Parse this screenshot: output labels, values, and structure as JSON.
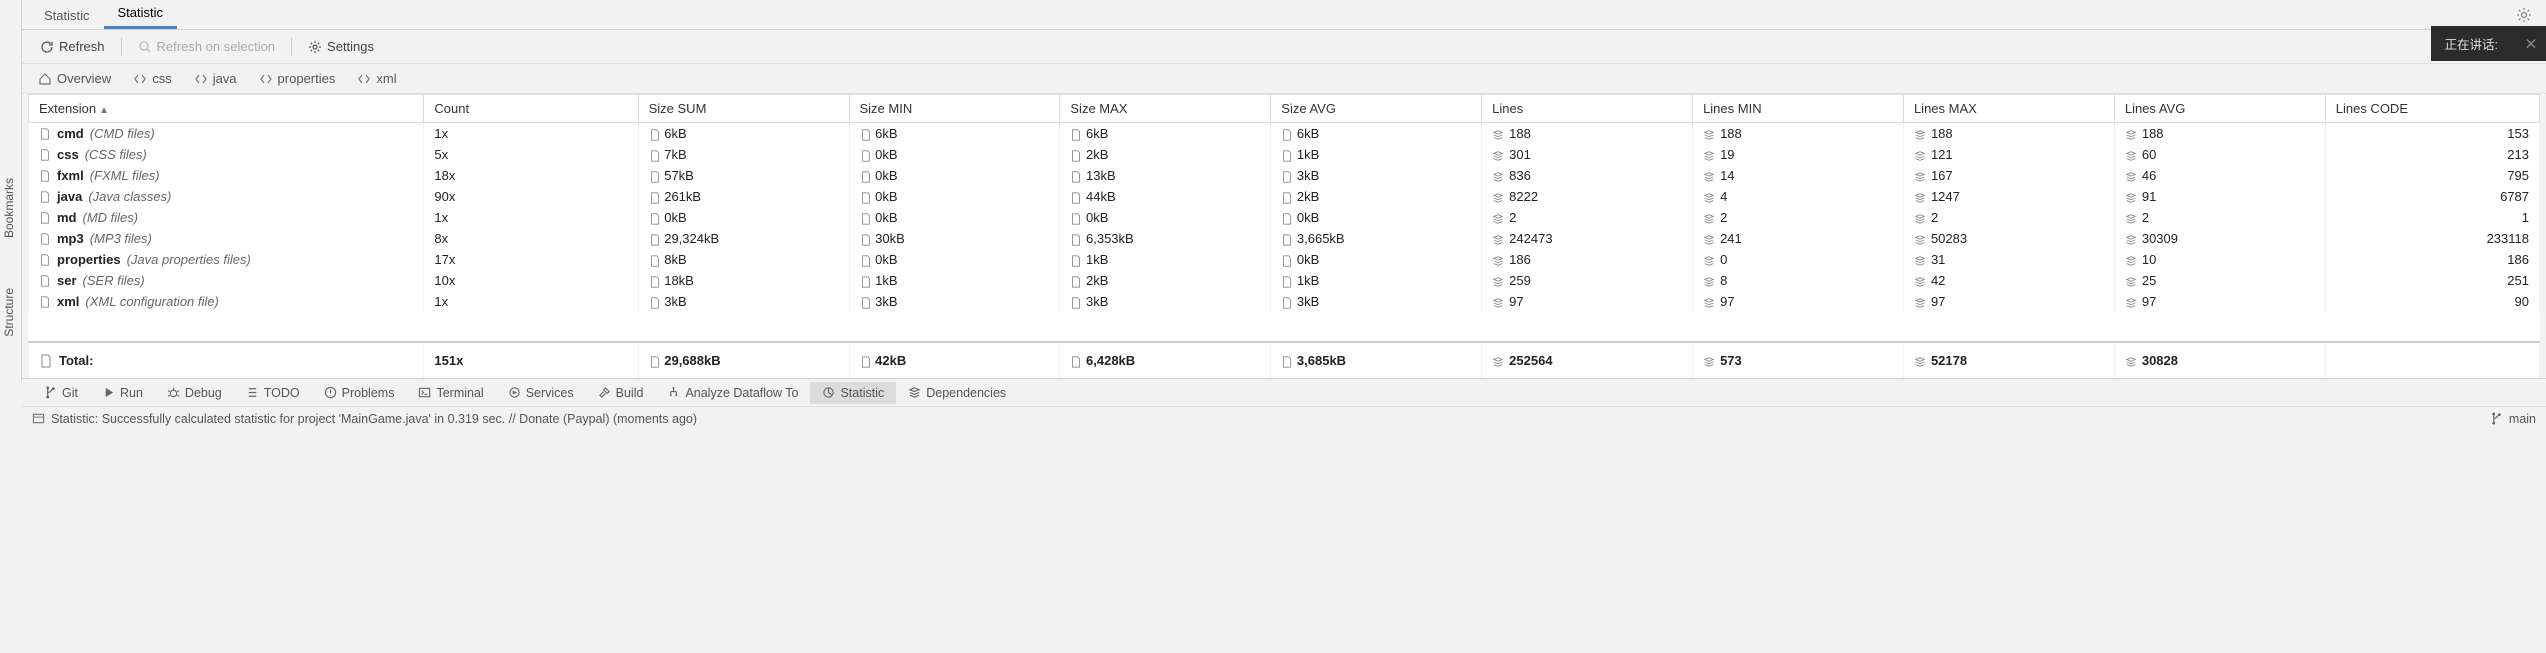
{
  "top_tabs": {
    "tab1": "Statistic",
    "tab2": "Statistic"
  },
  "toolbar": {
    "refresh": "Refresh",
    "refresh_selection": "Refresh on selection",
    "settings": "Settings"
  },
  "breadcrumb": {
    "overview": "Overview",
    "css": "css",
    "java": "java",
    "properties": "properties",
    "xml": "xml"
  },
  "columns": {
    "extension": "Extension",
    "count": "Count",
    "size_sum": "Size SUM",
    "size_min": "Size MIN",
    "size_max": "Size MAX",
    "size_avg": "Size AVG",
    "lines": "Lines",
    "lines_min": "Lines MIN",
    "lines_max": "Lines MAX",
    "lines_avg": "Lines AVG",
    "lines_code": "Lines CODE"
  },
  "rows": [
    {
      "ext": "cmd",
      "desc": "(CMD files)",
      "count": "1x",
      "size_sum": "6kB",
      "size_min": "6kB",
      "size_max": "6kB",
      "size_avg": "6kB",
      "lines": "188",
      "lines_min": "188",
      "lines_max": "188",
      "lines_avg": "188",
      "lines_code": "153"
    },
    {
      "ext": "css",
      "desc": "(CSS files)",
      "count": "5x",
      "size_sum": "7kB",
      "size_min": "0kB",
      "size_max": "2kB",
      "size_avg": "1kB",
      "lines": "301",
      "lines_min": "19",
      "lines_max": "121",
      "lines_avg": "60",
      "lines_code": "213"
    },
    {
      "ext": "fxml",
      "desc": "(FXML files)",
      "count": "18x",
      "size_sum": "57kB",
      "size_min": "0kB",
      "size_max": "13kB",
      "size_avg": "3kB",
      "lines": "836",
      "lines_min": "14",
      "lines_max": "167",
      "lines_avg": "46",
      "lines_code": "795"
    },
    {
      "ext": "java",
      "desc": "(Java classes)",
      "count": "90x",
      "size_sum": "261kB",
      "size_min": "0kB",
      "size_max": "44kB",
      "size_avg": "2kB",
      "lines": "8222",
      "lines_min": "4",
      "lines_max": "1247",
      "lines_avg": "91",
      "lines_code": "6787"
    },
    {
      "ext": "md",
      "desc": "(MD files)",
      "count": "1x",
      "size_sum": "0kB",
      "size_min": "0kB",
      "size_max": "0kB",
      "size_avg": "0kB",
      "lines": "2",
      "lines_min": "2",
      "lines_max": "2",
      "lines_avg": "2",
      "lines_code": "1"
    },
    {
      "ext": "mp3",
      "desc": "(MP3 files)",
      "count": "8x",
      "size_sum": "29,324kB",
      "size_min": "30kB",
      "size_max": "6,353kB",
      "size_avg": "3,665kB",
      "lines": "242473",
      "lines_min": "241",
      "lines_max": "50283",
      "lines_avg": "30309",
      "lines_code": "233118"
    },
    {
      "ext": "properties",
      "desc": "(Java properties files)",
      "count": "17x",
      "size_sum": "8kB",
      "size_min": "0kB",
      "size_max": "1kB",
      "size_avg": "0kB",
      "lines": "186",
      "lines_min": "0",
      "lines_max": "31",
      "lines_avg": "10",
      "lines_code": "186"
    },
    {
      "ext": "ser",
      "desc": "(SER files)",
      "count": "10x",
      "size_sum": "18kB",
      "size_min": "1kB",
      "size_max": "2kB",
      "size_avg": "1kB",
      "lines": "259",
      "lines_min": "8",
      "lines_max": "42",
      "lines_avg": "25",
      "lines_code": "251"
    },
    {
      "ext": "xml",
      "desc": "(XML configuration file)",
      "count": "1x",
      "size_sum": "3kB",
      "size_min": "3kB",
      "size_max": "3kB",
      "size_avg": "3kB",
      "lines": "97",
      "lines_min": "97",
      "lines_max": "97",
      "lines_avg": "97",
      "lines_code": "90"
    }
  ],
  "total": {
    "label": "Total:",
    "count": "151x",
    "size_sum": "29,688kB",
    "size_min": "42kB",
    "size_max": "6,428kB",
    "size_avg": "3,685kB",
    "lines": "252564",
    "lines_min": "573",
    "lines_max": "52178",
    "lines_avg": "30828",
    "lines_code": ""
  },
  "bottom": {
    "git": "Git",
    "run": "Run",
    "debug": "Debug",
    "todo": "TODO",
    "problems": "Problems",
    "terminal": "Terminal",
    "services": "Services",
    "build": "Build",
    "analyze": "Analyze Dataflow To",
    "statistic": "Statistic",
    "dependencies": "Dependencies"
  },
  "sidebar": {
    "bookmarks": "Bookmarks",
    "structure": "Structure"
  },
  "status": {
    "message": "Statistic: Successfully calculated statistic for project 'MainGame.java' in 0.319 sec. // Donate (Paypal) (moments ago)",
    "branch": "main"
  },
  "notification": {
    "text": "正在讲话:"
  }
}
